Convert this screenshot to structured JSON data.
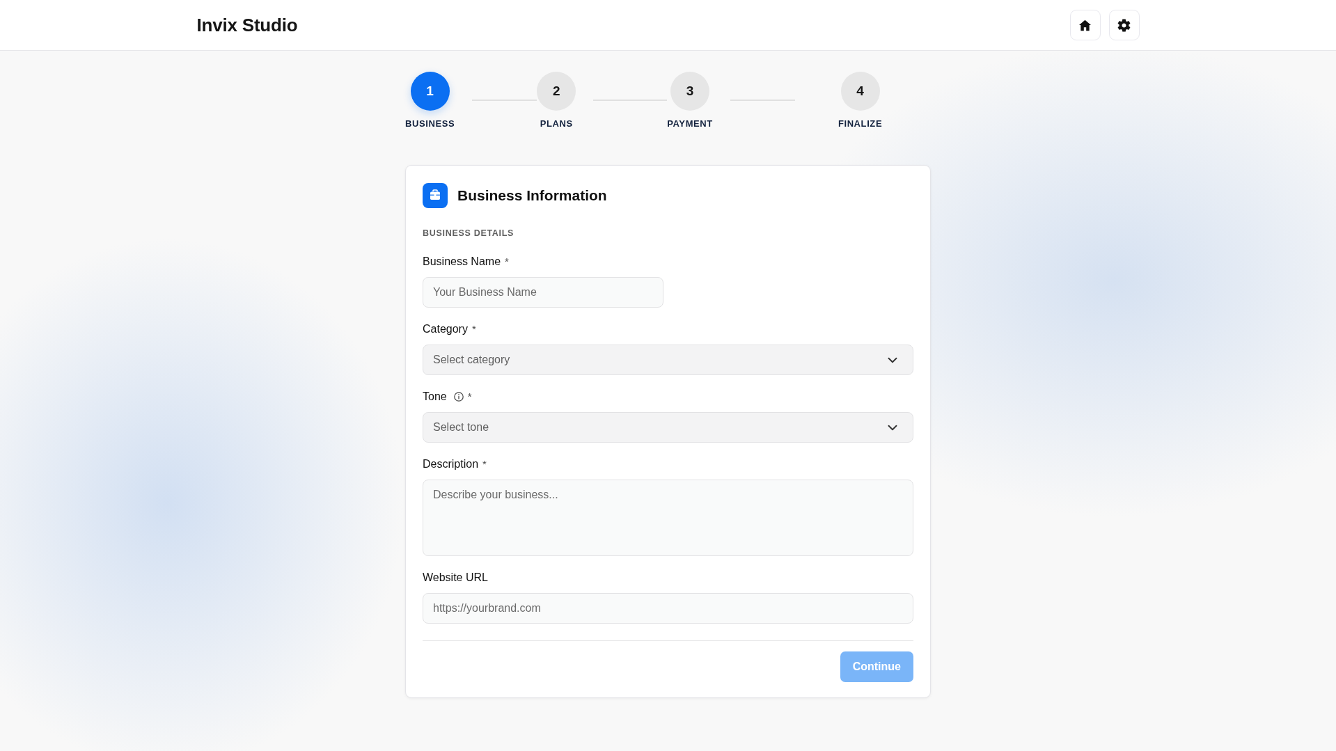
{
  "header": {
    "title": "Invix Studio"
  },
  "steps": [
    {
      "number": "1",
      "label": "BUSINESS",
      "selected": true
    },
    {
      "number": "2",
      "label": "PLANS",
      "selected": false
    },
    {
      "number": "3",
      "label": "PAYMENT",
      "selected": false
    },
    {
      "number": "4",
      "label": "FINALIZE",
      "selected": false
    }
  ],
  "card": {
    "title": "Business Information",
    "section": "BUSINESS DETAILS",
    "fields": [
      {
        "kind": "text",
        "label": "Business Name",
        "required_mark": "*",
        "placeholder": "Your Business Name"
      },
      {
        "kind": "select",
        "label": "Category",
        "required_mark": "*",
        "placeholder": "Select category"
      },
      {
        "kind": "select",
        "label": "Tone",
        "info": true,
        "required_mark": "*",
        "placeholder": "Select tone"
      },
      {
        "kind": "textarea",
        "label": "Description",
        "required_mark": "*",
        "placeholder": "Describe your business..."
      },
      {
        "kind": "text",
        "label": "Website URL",
        "placeholder": "https://yourbrand.com"
      }
    ],
    "continue_button": {
      "label": "Continue",
      "disabled": true
    }
  }
}
